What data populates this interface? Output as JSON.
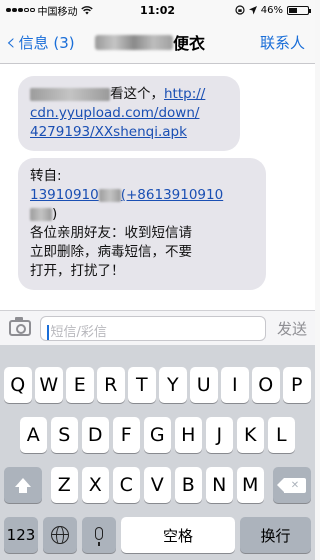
{
  "status_bar": {
    "carrier": "中国移动",
    "time": "11:02",
    "battery": "46%",
    "battery_level": 0.46
  },
  "nav": {
    "back_label": "信息 (3)",
    "contact_suffix": "便衣",
    "contacts_label": "联系人"
  },
  "messages": [
    {
      "prefix": "看这个，",
      "link_lines": [
        "http://",
        "cdn.yyupload.com/down/",
        "4279193/XXshenqi.apk"
      ]
    },
    {
      "forward_label": "转自:",
      "phone_main": "13910910",
      "phone_alt_open": "(+8613910910",
      "phone_alt_close": ")",
      "body_lines": [
        "各位亲朋好友：收到短信请",
        "立即删除，病毒短信，不要",
        "打开，打扰了！"
      ]
    }
  ],
  "input": {
    "placeholder": "短信/彩信",
    "send_label": "发送"
  },
  "keyboard": {
    "row1": [
      "Q",
      "W",
      "E",
      "R",
      "T",
      "Y",
      "U",
      "I",
      "O",
      "P"
    ],
    "row2": [
      "A",
      "S",
      "D",
      "F",
      "G",
      "H",
      "J",
      "K",
      "L"
    ],
    "row3": [
      "Z",
      "X",
      "C",
      "V",
      "B",
      "N",
      "M"
    ],
    "numbers_label": "123",
    "space_label": "空格",
    "return_label": "换行"
  }
}
